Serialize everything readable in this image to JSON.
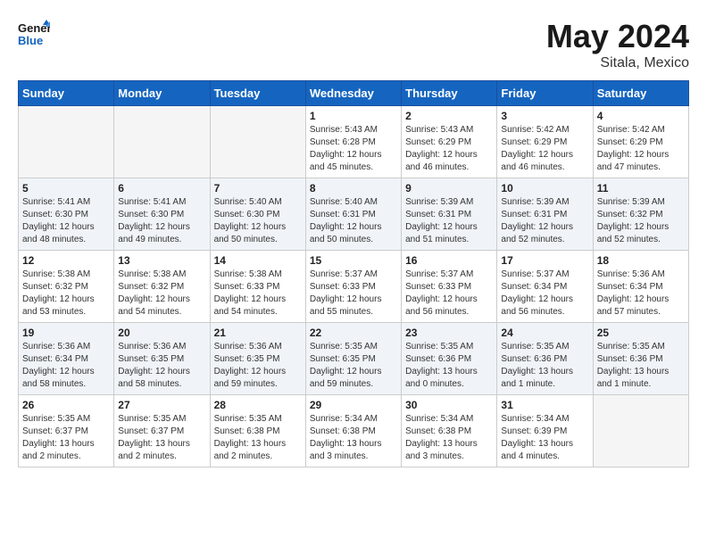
{
  "header": {
    "logo_general": "General",
    "logo_blue": "Blue",
    "month_year": "May 2024",
    "location": "Sitala, Mexico"
  },
  "days_of_week": [
    "Sunday",
    "Monday",
    "Tuesday",
    "Wednesday",
    "Thursday",
    "Friday",
    "Saturday"
  ],
  "weeks": [
    [
      {
        "day": "",
        "info": ""
      },
      {
        "day": "",
        "info": ""
      },
      {
        "day": "",
        "info": ""
      },
      {
        "day": "1",
        "info": "Sunrise: 5:43 AM\nSunset: 6:28 PM\nDaylight: 12 hours\nand 45 minutes."
      },
      {
        "day": "2",
        "info": "Sunrise: 5:43 AM\nSunset: 6:29 PM\nDaylight: 12 hours\nand 46 minutes."
      },
      {
        "day": "3",
        "info": "Sunrise: 5:42 AM\nSunset: 6:29 PM\nDaylight: 12 hours\nand 46 minutes."
      },
      {
        "day": "4",
        "info": "Sunrise: 5:42 AM\nSunset: 6:29 PM\nDaylight: 12 hours\nand 47 minutes."
      }
    ],
    [
      {
        "day": "5",
        "info": "Sunrise: 5:41 AM\nSunset: 6:30 PM\nDaylight: 12 hours\nand 48 minutes."
      },
      {
        "day": "6",
        "info": "Sunrise: 5:41 AM\nSunset: 6:30 PM\nDaylight: 12 hours\nand 49 minutes."
      },
      {
        "day": "7",
        "info": "Sunrise: 5:40 AM\nSunset: 6:30 PM\nDaylight: 12 hours\nand 50 minutes."
      },
      {
        "day": "8",
        "info": "Sunrise: 5:40 AM\nSunset: 6:31 PM\nDaylight: 12 hours\nand 50 minutes."
      },
      {
        "day": "9",
        "info": "Sunrise: 5:39 AM\nSunset: 6:31 PM\nDaylight: 12 hours\nand 51 minutes."
      },
      {
        "day": "10",
        "info": "Sunrise: 5:39 AM\nSunset: 6:31 PM\nDaylight: 12 hours\nand 52 minutes."
      },
      {
        "day": "11",
        "info": "Sunrise: 5:39 AM\nSunset: 6:32 PM\nDaylight: 12 hours\nand 52 minutes."
      }
    ],
    [
      {
        "day": "12",
        "info": "Sunrise: 5:38 AM\nSunset: 6:32 PM\nDaylight: 12 hours\nand 53 minutes."
      },
      {
        "day": "13",
        "info": "Sunrise: 5:38 AM\nSunset: 6:32 PM\nDaylight: 12 hours\nand 54 minutes."
      },
      {
        "day": "14",
        "info": "Sunrise: 5:38 AM\nSunset: 6:33 PM\nDaylight: 12 hours\nand 54 minutes."
      },
      {
        "day": "15",
        "info": "Sunrise: 5:37 AM\nSunset: 6:33 PM\nDaylight: 12 hours\nand 55 minutes."
      },
      {
        "day": "16",
        "info": "Sunrise: 5:37 AM\nSunset: 6:33 PM\nDaylight: 12 hours\nand 56 minutes."
      },
      {
        "day": "17",
        "info": "Sunrise: 5:37 AM\nSunset: 6:34 PM\nDaylight: 12 hours\nand 56 minutes."
      },
      {
        "day": "18",
        "info": "Sunrise: 5:36 AM\nSunset: 6:34 PM\nDaylight: 12 hours\nand 57 minutes."
      }
    ],
    [
      {
        "day": "19",
        "info": "Sunrise: 5:36 AM\nSunset: 6:34 PM\nDaylight: 12 hours\nand 58 minutes."
      },
      {
        "day": "20",
        "info": "Sunrise: 5:36 AM\nSunset: 6:35 PM\nDaylight: 12 hours\nand 58 minutes."
      },
      {
        "day": "21",
        "info": "Sunrise: 5:36 AM\nSunset: 6:35 PM\nDaylight: 12 hours\nand 59 minutes."
      },
      {
        "day": "22",
        "info": "Sunrise: 5:35 AM\nSunset: 6:35 PM\nDaylight: 12 hours\nand 59 minutes."
      },
      {
        "day": "23",
        "info": "Sunrise: 5:35 AM\nSunset: 6:36 PM\nDaylight: 13 hours\nand 0 minutes."
      },
      {
        "day": "24",
        "info": "Sunrise: 5:35 AM\nSunset: 6:36 PM\nDaylight: 13 hours\nand 1 minute."
      },
      {
        "day": "25",
        "info": "Sunrise: 5:35 AM\nSunset: 6:36 PM\nDaylight: 13 hours\nand 1 minute."
      }
    ],
    [
      {
        "day": "26",
        "info": "Sunrise: 5:35 AM\nSunset: 6:37 PM\nDaylight: 13 hours\nand 2 minutes."
      },
      {
        "day": "27",
        "info": "Sunrise: 5:35 AM\nSunset: 6:37 PM\nDaylight: 13 hours\nand 2 minutes."
      },
      {
        "day": "28",
        "info": "Sunrise: 5:35 AM\nSunset: 6:38 PM\nDaylight: 13 hours\nand 2 minutes."
      },
      {
        "day": "29",
        "info": "Sunrise: 5:34 AM\nSunset: 6:38 PM\nDaylight: 13 hours\nand 3 minutes."
      },
      {
        "day": "30",
        "info": "Sunrise: 5:34 AM\nSunset: 6:38 PM\nDaylight: 13 hours\nand 3 minutes."
      },
      {
        "day": "31",
        "info": "Sunrise: 5:34 AM\nSunset: 6:39 PM\nDaylight: 13 hours\nand 4 minutes."
      },
      {
        "day": "",
        "info": ""
      }
    ]
  ]
}
